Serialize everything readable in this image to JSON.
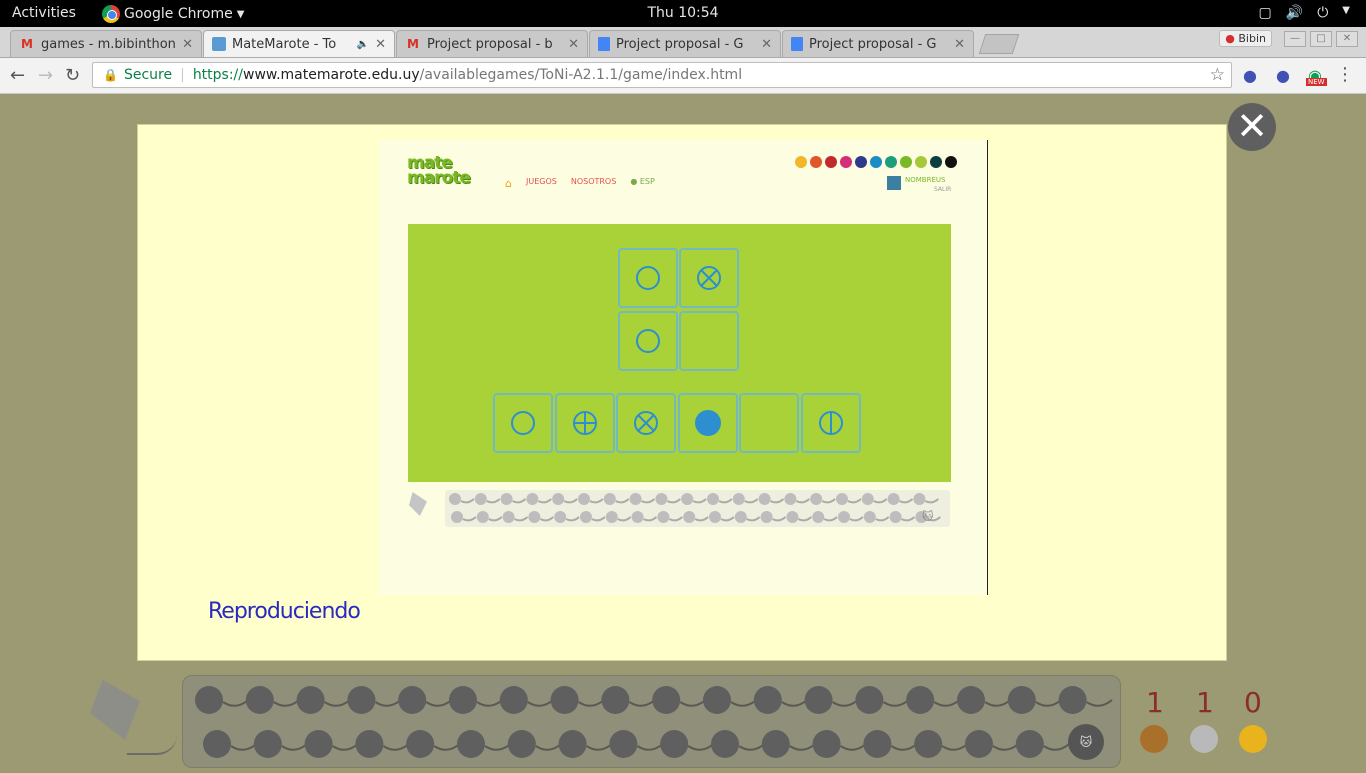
{
  "system_bar": {
    "activities": "Activities",
    "app_name": "Google Chrome",
    "clock": "Thu 10:54"
  },
  "tabs": [
    {
      "title": "games - m.bibinthon",
      "icon": "gmail-icon"
    },
    {
      "title": "MateMarote - To",
      "icon": "matemarote-icon",
      "active": true
    },
    {
      "title": "Project proposal - b",
      "icon": "gmail-icon"
    },
    {
      "title": "Project proposal - G",
      "icon": "docs-icon"
    },
    {
      "title": "Project proposal - G",
      "icon": "docs-icon"
    }
  ],
  "profile_badge": "Bibin",
  "address_bar": {
    "secure_label": "Secure",
    "url_scheme": "https://",
    "url_host": "www.matemarote.edu.uy",
    "url_path": "/availablegames/ToNi-A2.1.1/game/index.html"
  },
  "video": {
    "logo_line1": "mate",
    "logo_line2": "marote",
    "nav": {
      "juegos": "JUEGOS",
      "nosotros": "NOSOTROS",
      "esp": "ESP"
    },
    "user_name": "NOMBREUS",
    "user_logout": "SALIR",
    "color_dots": [
      "#f1b72a",
      "#e2552b",
      "#c0292d",
      "#d52d7a",
      "#2e3a8c",
      "#1c8cc6",
      "#1c9e7a",
      "#7ab827",
      "#a6c93a",
      "#0e3f3f",
      "#111111"
    ],
    "top_grid": [
      [
        "circle",
        "circle-x"
      ],
      [
        "circle",
        "empty"
      ]
    ],
    "bottom_row": [
      "circle",
      "circle-plus",
      "circle-x",
      "filled-dot",
      "empty",
      "circle-bar"
    ]
  },
  "status_text": "Reproduciendo",
  "scores": {
    "bronze": "1",
    "silver": "1",
    "gold": "0"
  },
  "colors": {
    "modal_bg": "#ffffcc",
    "field_green": "#a8d237",
    "symbol_blue": "#2d8fcf"
  }
}
